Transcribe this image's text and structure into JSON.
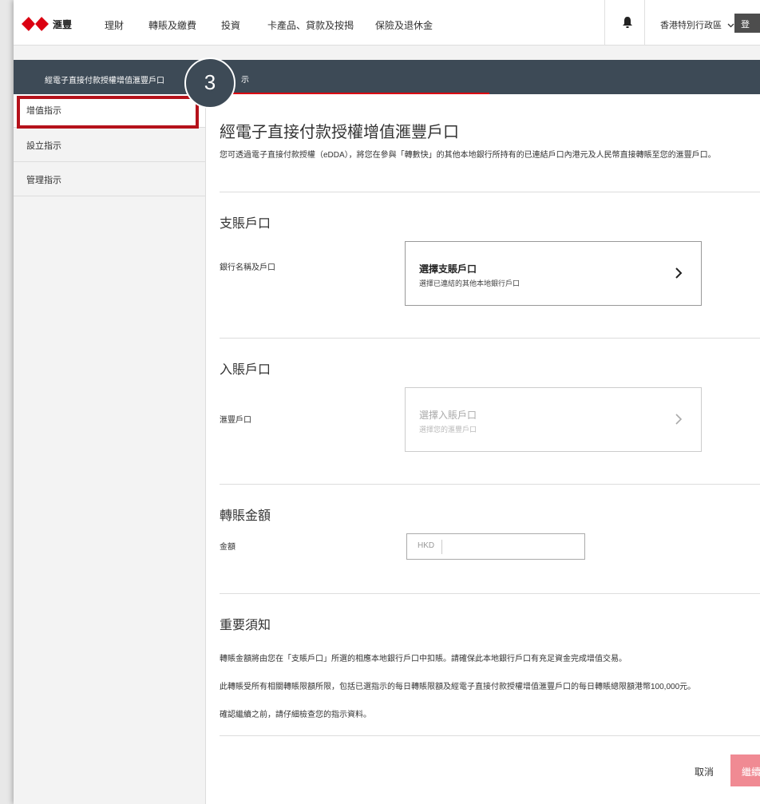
{
  "brand": {
    "name": "滙豐",
    "accent": "#db0011",
    "dark_header": "#3d4a56",
    "highlight": "#b5121b"
  },
  "topnav": {
    "items": [
      "理財",
      "轉賬及繳費",
      "投資",
      "卡產品、貸款及按揭",
      "保險及退休金"
    ],
    "region": "香港特別行政區",
    "login": "登"
  },
  "header": {
    "title": "經電子直接付款授權增值滙豐戶口",
    "active_tab": "示"
  },
  "step_badge": "3",
  "sidebar": {
    "items": [
      {
        "label": "增值指示"
      },
      {
        "label": "設立指示"
      },
      {
        "label": "管理指示"
      }
    ]
  },
  "main": {
    "title": "經電子直接付款授權增值滙豐戶口",
    "intro": "您可透過電子直接付款授權（eDDA），將您在參與「轉數快」的其他本地銀行所持有的已連結戶口內港元及人民幣直接轉賬至您的滙豐戶口。",
    "debit": {
      "section_title": "支賬戶口",
      "label": "銀行名稱及戶口",
      "select_title": "選擇支賬戶口",
      "select_sub": "選擇已連結的其他本地銀行戶口"
    },
    "credit": {
      "section_title": "入賬戶口",
      "label": "滙豐戶口",
      "select_title": "選擇入賬戶口",
      "select_sub": "選擇您的滙豐戶口"
    },
    "amount": {
      "section_title": "轉賬金額",
      "label": "金額",
      "currency": "HKD",
      "value": ""
    },
    "notice": {
      "section_title": "重要須知",
      "lines": [
        "轉賬金額將由您在「支賬戶口」所選的相應本地銀行戶口中扣賬。請確保此本地銀行戶口有充足資金完成增值交易。",
        "此轉賬受所有相關轉賬限額所限，包括已選指示的每日轉賬限額及經電子直接付款授權增值滙豐戶口的每日轉賬總限額港幣100,000元。",
        "確認繼續之前，請仔細檢查您的指示資料。"
      ]
    },
    "actions": {
      "cancel": "取消",
      "continue": "繼續"
    }
  }
}
